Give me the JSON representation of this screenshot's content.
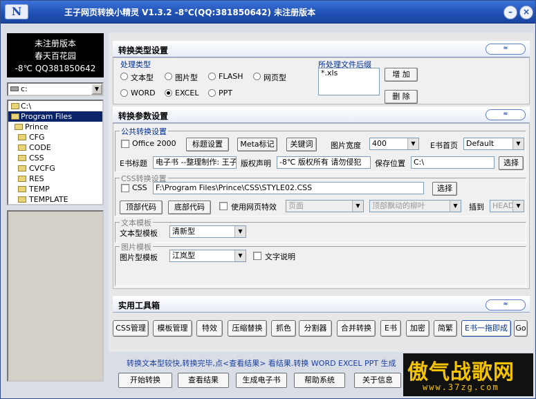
{
  "titlebar": {
    "logo": "N",
    "title": "王子网页转换小精灵 V1.3.2 -8℃(QQ:381850642) 未注册版本",
    "min": "–",
    "close": "×"
  },
  "left": {
    "license_lines": [
      "未注册版本",
      "春天百花园",
      "-8℃ QQ381850642"
    ],
    "drive": "c:",
    "tree": [
      {
        "label": "C:\\",
        "level": 0,
        "selected": false
      },
      {
        "label": "Program Files",
        "level": 0,
        "selected": true
      },
      {
        "label": "Prince",
        "level": 1,
        "selected": false
      },
      {
        "label": "CFG",
        "level": 2,
        "selected": false
      },
      {
        "label": "CODE",
        "level": 2,
        "selected": false
      },
      {
        "label": "CSS",
        "level": 2,
        "selected": false
      },
      {
        "label": "CVCFG",
        "level": 2,
        "selected": false
      },
      {
        "label": "RES",
        "level": 2,
        "selected": false
      },
      {
        "label": "TEMP",
        "level": 2,
        "selected": false
      },
      {
        "label": "TEMPLATE",
        "level": 2,
        "selected": false
      }
    ]
  },
  "sec1": {
    "title": "转换类型设置",
    "chev": "≈"
  },
  "type": {
    "group_label": "处理类型",
    "radios": [
      "文本型",
      "图片型",
      "FLASH",
      "网页型",
      "WORD",
      "EXCEL",
      "PPT"
    ],
    "selected": "EXCEL",
    "ext_label": "所处理文件后缀",
    "ext_value": "*.xls",
    "add": "增 加",
    "del": "删 除"
  },
  "sec2": {
    "title": "转换参数设置",
    "chev": "≈"
  },
  "common": {
    "group": "公共转换设置",
    "office2000": "Office 2000",
    "title_btn": "标题设置",
    "meta_btn": "Meta标记",
    "kw_btn": "关键词",
    "width_label": "图片宽度",
    "width_value": "400",
    "home_label": "E书首页",
    "home_value": "Default",
    "ebook_title_label": "E书标题",
    "ebook_title_value": "电子书 --整理制作: 王子",
    "copyright_label": "版权声明",
    "copyright_value": "-8℃ 版权所有 请勿侵犯",
    "save_label": "保存位置",
    "save_value": "C:\\",
    "choose": "选择"
  },
  "css": {
    "group": "CSS转换设置",
    "css_label": "CSS",
    "css_path": "F:\\Program Files\\Prince\\CSS\\STYLE02.CSS",
    "choose": "选择",
    "top_code": "顶部代码",
    "bottom_code": "底部代码",
    "effect_label": "使用网页特效",
    "effect_value": "页面",
    "effect2_value": "顶部飘动的柳叶",
    "insert_label": "插到",
    "insert_value": "HEAD"
  },
  "text_tpl": {
    "group": "文本模板",
    "label": "文本型模板",
    "value": "清新型"
  },
  "img_tpl": {
    "group": "图片模板",
    "label": "图片型模板",
    "value": "江岚型",
    "caption": "文字说明"
  },
  "sec3": {
    "title": "实用工具箱",
    "chev": "≈"
  },
  "tools": [
    "CSS管理",
    "模板管理",
    "特效",
    "压缩替换",
    "抓色",
    "分割器",
    "合并转换",
    "E书",
    "加密",
    "简繁",
    "E书一拖即成",
    "Go"
  ],
  "status": "转换文本型较快,转换完毕,点<查看结果> 看结果.转换 WORD EXCEL PPT 生成",
  "bottom": [
    "开始转换",
    "查看结果",
    "生成电子书",
    "帮助系统",
    "关于信息"
  ],
  "watermark": {
    "main": "傲气战歌网",
    "url": "www.37zg.com"
  }
}
